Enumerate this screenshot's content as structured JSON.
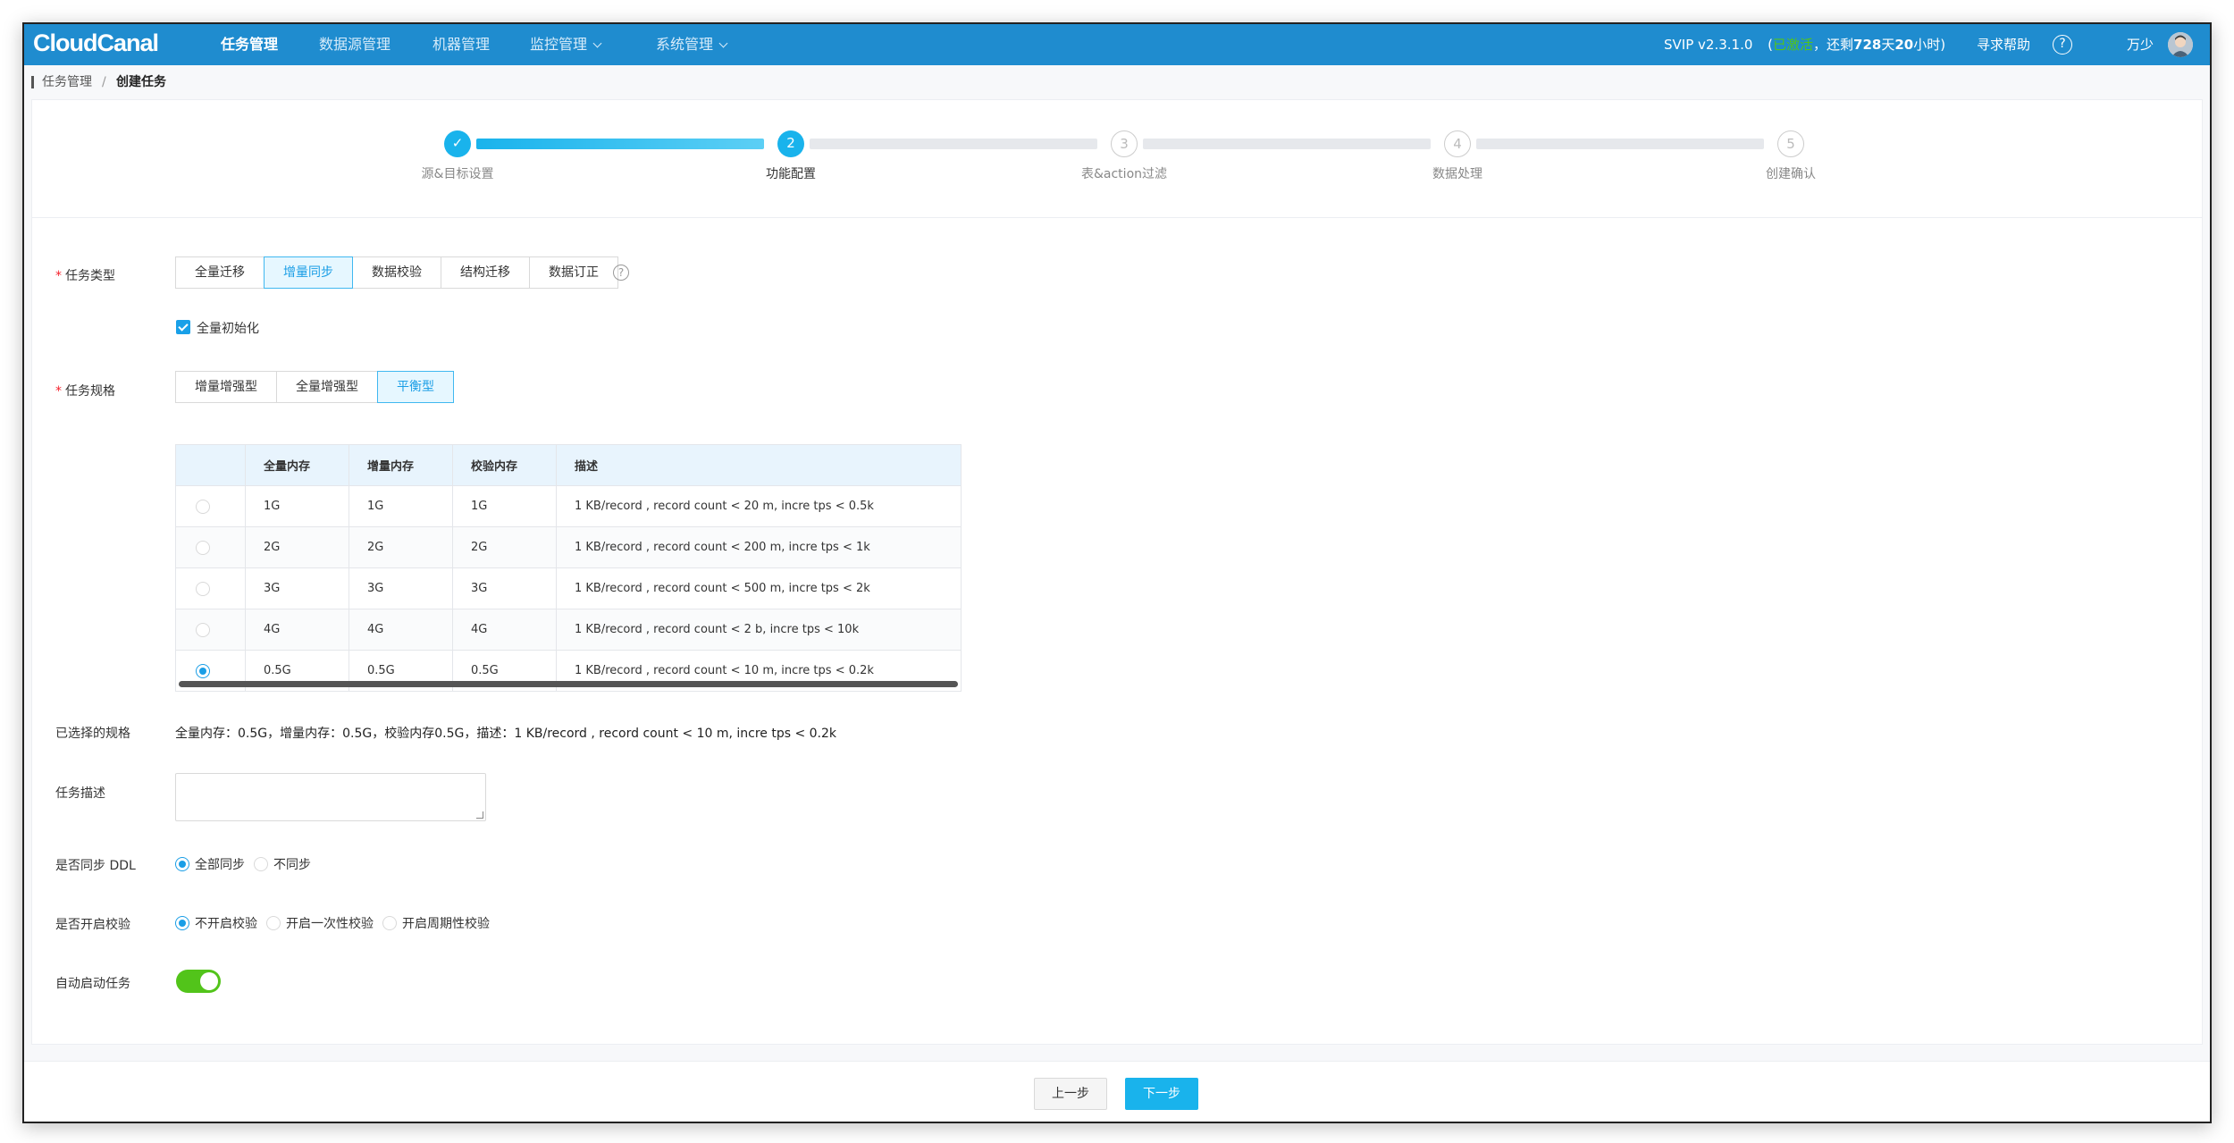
{
  "app": {
    "logo": "CloudCanal"
  },
  "nav": {
    "items": [
      {
        "label": "任务管理",
        "active": true
      },
      {
        "label": "数据源管理"
      },
      {
        "label": "机器管理"
      },
      {
        "label": "监控管理"
      },
      {
        "label": "系统管理"
      }
    ],
    "version": "SVIP v2.3.1.0",
    "license_open": "(",
    "license_status": "已激活",
    "license_sep": "，还剩",
    "license_days": "728",
    "license_days_unit": "天",
    "license_hours": "20",
    "license_hours_unit": "小时)",
    "help": "寻求帮助",
    "help_icon": "?",
    "user": "万少"
  },
  "breadcrumb": {
    "parent": "任务管理",
    "sep": "/",
    "current": "创建任务"
  },
  "steps": [
    {
      "index": "✓",
      "label": "源&目标设置",
      "state": "done"
    },
    {
      "index": "2",
      "label": "功能配置",
      "state": "current"
    },
    {
      "index": "3",
      "label": "表&action过滤",
      "state": "todo"
    },
    {
      "index": "4",
      "label": "数据处理",
      "state": "todo"
    },
    {
      "index": "5",
      "label": "创建确认",
      "state": "todo"
    }
  ],
  "task_type": {
    "required_mark": "*",
    "label": "任务类型",
    "options": [
      "全量迁移",
      "增量同步",
      "数据校验",
      "结构迁移",
      "数据订正"
    ],
    "selected": "增量同步",
    "help_icon": "?"
  },
  "full_init": {
    "label": "全量初始化",
    "checked": true
  },
  "task_spec": {
    "required_mark": "*",
    "label": "任务规格",
    "options": [
      "增量增强型",
      "全量增强型",
      "平衡型"
    ],
    "selected": "平衡型",
    "table": {
      "headers": [
        "",
        "全量内存",
        "增量内存",
        "校验内存",
        "描述"
      ],
      "rows": [
        {
          "full": "1G",
          "incr": "1G",
          "check": "1G",
          "desc": "1 KB/record , record count < 20 m, incre tps < 0.5k",
          "selected": false
        },
        {
          "full": "2G",
          "incr": "2G",
          "check": "2G",
          "desc": "1 KB/record , record count < 200 m, incre tps < 1k",
          "selected": false
        },
        {
          "full": "3G",
          "incr": "3G",
          "check": "3G",
          "desc": "1 KB/record , record count < 500 m, incre tps < 2k",
          "selected": false
        },
        {
          "full": "4G",
          "incr": "4G",
          "check": "4G",
          "desc": "1 KB/record , record count < 2 b, incre tps < 10k",
          "selected": false
        },
        {
          "full": "0.5G",
          "incr": "0.5G",
          "check": "0.5G",
          "desc": "1 KB/record , record count < 10 m, incre tps < 0.2k",
          "selected": true
        }
      ]
    }
  },
  "selected_spec": {
    "label": "已选择的规格",
    "value": "全量内存：0.5G，增量内存：0.5G，校验内存0.5G，描述：1 KB/record , record count < 10 m, incre tps < 0.2k"
  },
  "task_desc": {
    "label": "任务描述",
    "value": ""
  },
  "sync_ddl": {
    "label": "是否同步 DDL",
    "options": [
      "全部同步",
      "不同步"
    ],
    "selected": "全部同步"
  },
  "verify": {
    "label": "是否开启校验",
    "options": [
      "不开启校验",
      "开启一次性校验",
      "开启周期性校验"
    ],
    "selected": "不开启校验"
  },
  "auto_start": {
    "label": "自动启动任务",
    "enabled": true
  },
  "footer": {
    "prev": "上一步",
    "next": "下一步"
  },
  "colors": {
    "primary": "#19b3ec",
    "nav_bg": "#1f8ccf",
    "success": "#52c41a",
    "required": "#f5222d"
  }
}
